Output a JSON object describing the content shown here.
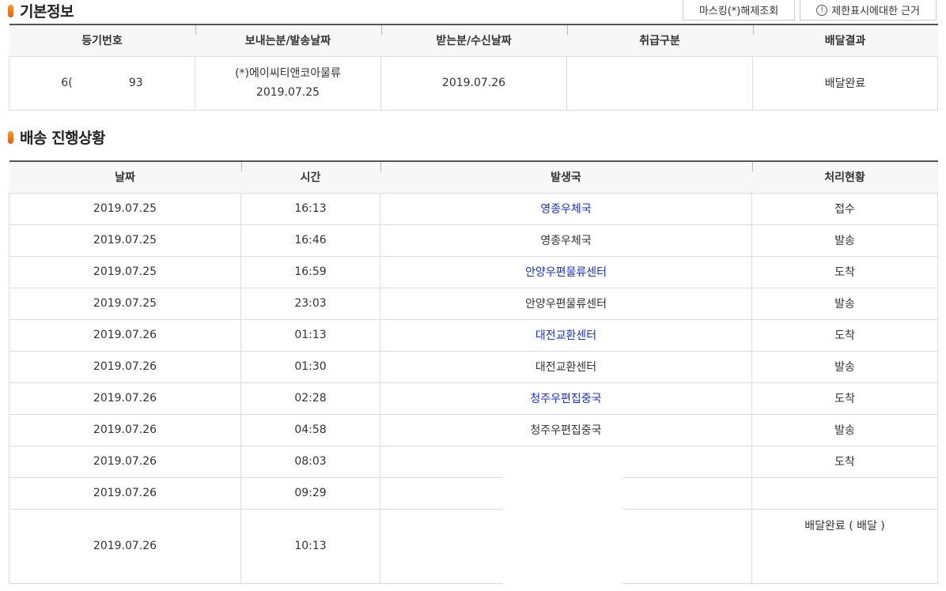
{
  "basic": {
    "title": "기본정보",
    "buttons": {
      "unmask": "마스킹(*)해제조회",
      "restrict_icon_char": "!",
      "restrict": "제한표시에대한 근거"
    },
    "headers": [
      "등기번호",
      "보내는분/발송날짜",
      "받는분/수신날짜",
      "취급구분",
      "배달결과"
    ],
    "row": {
      "reg_no": "6(                93",
      "sender": "(*)에이씨티앤코아물류",
      "send_date": "2019.07.25",
      "receiver": "",
      "recv_date": "2019.07.26",
      "handling": "",
      "result": "배달완료"
    }
  },
  "tracking": {
    "title": "배송 진행상황",
    "headers": [
      "날짜",
      "시간",
      "발생국",
      "처리현황"
    ],
    "rows": [
      {
        "date": "2019.07.25",
        "time": "16:13",
        "office": "영종우체국",
        "status": "접수"
      },
      {
        "date": "2019.07.25",
        "time": "16:46",
        "office": "영종우체국",
        "status": "발송"
      },
      {
        "date": "2019.07.25",
        "time": "16:59",
        "office": "안양우편물류센터",
        "status": "도착"
      },
      {
        "date": "2019.07.25",
        "time": "23:03",
        "office": "안양우편물류센터",
        "status": "발송"
      },
      {
        "date": "2019.07.26",
        "time": "01:13",
        "office": "대전교환센터",
        "status": "도착"
      },
      {
        "date": "2019.07.26",
        "time": "01:30",
        "office": "대전교환센터",
        "status": "발송"
      },
      {
        "date": "2019.07.26",
        "time": "02:28",
        "office": "청주우편집중국",
        "status": "도착"
      },
      {
        "date": "2019.07.26",
        "time": "04:58",
        "office": "청주우편집중국",
        "status": "발송"
      },
      {
        "date": "2019.07.26",
        "time": "08:03",
        "office": "",
        "status": "도착"
      },
      {
        "date": "2019.07.26",
        "time": "09:29",
        "office": "",
        "status": ""
      },
      {
        "date": "2019.07.26",
        "time": "10:13",
        "office": "",
        "status": "배달완료 ( 배달 )"
      }
    ]
  },
  "colors": {
    "accent": "#e8731f",
    "link": "#1a2fd6",
    "header_bg": "#f7f7f7",
    "border": "#dddddd"
  }
}
